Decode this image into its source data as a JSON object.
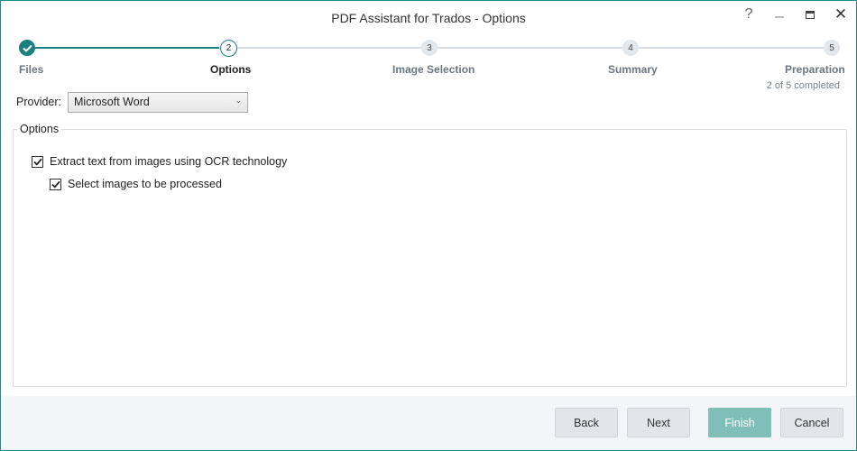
{
  "window": {
    "title": "PDF Assistant for Trados - Options",
    "help_label": "?",
    "close_label": "✕"
  },
  "steps": [
    {
      "number": "1",
      "label": "Files",
      "state": "done"
    },
    {
      "number": "2",
      "label": "Options",
      "state": "current"
    },
    {
      "number": "3",
      "label": "Image Selection",
      "state": "pending"
    },
    {
      "number": "4",
      "label": "Summary",
      "state": "pending"
    },
    {
      "number": "5",
      "label": "Preparation",
      "state": "pending"
    }
  ],
  "progress": {
    "text": "2 of 5 completed",
    "completed": 2,
    "total": 5
  },
  "provider": {
    "label": "Provider:",
    "value": "Microsoft Word"
  },
  "options": {
    "legend": "Options",
    "ocr_label": "Extract text from images using OCR technology",
    "ocr_checked": true,
    "select_images_label": "Select images to be processed",
    "select_images_checked": true
  },
  "footer": {
    "back": "Back",
    "next": "Next",
    "finish": "Finish",
    "cancel": "Cancel"
  },
  "colors": {
    "accent": "#1b7f7f",
    "finish_button": "#7fbfb8"
  },
  "icons": {
    "check": "checkmark-icon",
    "chevron": "chevron-down-icon"
  }
}
